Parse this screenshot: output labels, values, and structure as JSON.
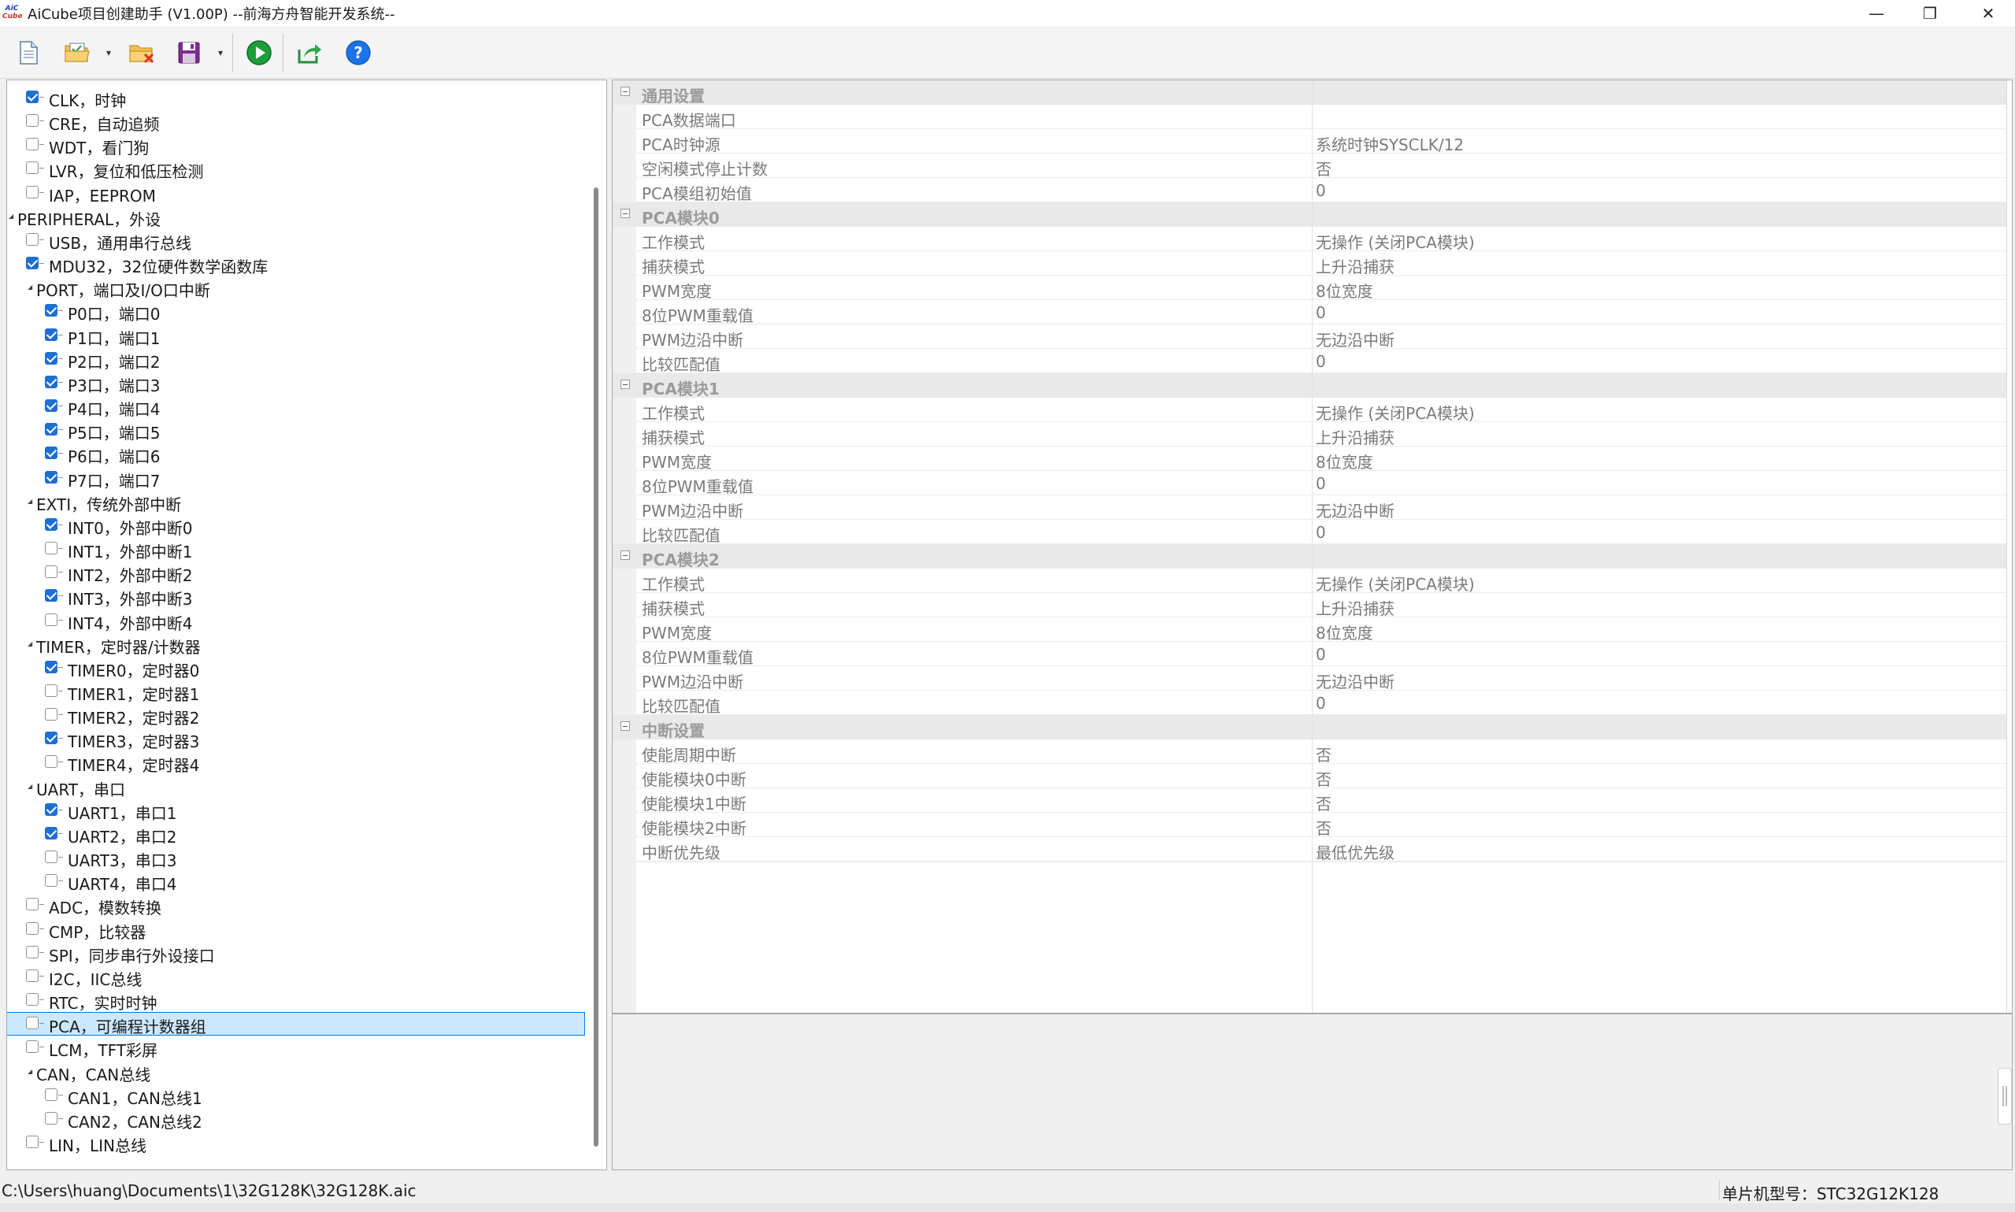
{
  "window": {
    "logo_text_top": "AiC",
    "logo_text_bottom": "Cube",
    "title": "AiCube项目创建助手 (V1.00P) --前海方舟智能开发系统--",
    "minimize_glyph": "—",
    "restore_glyph": "❐",
    "close_glyph": "✕"
  },
  "toolbar": {
    "buttons": [
      {
        "name": "new-project-button",
        "icon": "new-file-icon"
      },
      {
        "name": "open-project-button",
        "icon": "open-folder-icon"
      },
      {
        "name": "close-project-button",
        "icon": "close-folder-icon"
      },
      {
        "name": "save-project-button",
        "icon": "save-disk-icon"
      },
      {
        "name": "run-generate-button",
        "icon": "play-icon"
      },
      {
        "name": "export-button",
        "icon": "export-share-icon"
      },
      {
        "name": "help-button",
        "icon": "help-icon"
      }
    ],
    "dropdown_glyph": "▾"
  },
  "colors": {
    "accent": "#1f6fd1",
    "selection": "#cce8ff",
    "selection_border": "#0078d7",
    "play_green": "#1e9e3a",
    "help_blue": "#1a73e8"
  },
  "tree": {
    "items": [
      {
        "label": "CLK，时钟",
        "level": 1,
        "checkbox": true,
        "checked": true
      },
      {
        "label": "CRE，自动追频",
        "level": 1,
        "checkbox": true,
        "checked": false
      },
      {
        "label": "WDT，看门狗",
        "level": 1,
        "checkbox": true,
        "checked": false
      },
      {
        "label": "LVR，复位和低压检测",
        "level": 1,
        "checkbox": true,
        "checked": false
      },
      {
        "label": "IAP，EEPROM",
        "level": 1,
        "checkbox": true,
        "checked": false
      },
      {
        "label": "PERIPHERAL，外设",
        "level": 0,
        "checkbox": false,
        "expanded": true
      },
      {
        "label": "USB，通用串行总线",
        "level": 1,
        "checkbox": true,
        "checked": false
      },
      {
        "label": "MDU32，32位硬件数学函数库",
        "level": 1,
        "checkbox": true,
        "checked": true
      },
      {
        "label": "PORT，端口及I/O口中断",
        "level": 1,
        "checkbox": false,
        "expanded": true
      },
      {
        "label": "P0口，端口0",
        "level": 2,
        "checkbox": true,
        "checked": true
      },
      {
        "label": "P1口，端口1",
        "level": 2,
        "checkbox": true,
        "checked": true
      },
      {
        "label": "P2口，端口2",
        "level": 2,
        "checkbox": true,
        "checked": true
      },
      {
        "label": "P3口，端口3",
        "level": 2,
        "checkbox": true,
        "checked": true
      },
      {
        "label": "P4口，端口4",
        "level": 2,
        "checkbox": true,
        "checked": true
      },
      {
        "label": "P5口，端口5",
        "level": 2,
        "checkbox": true,
        "checked": true
      },
      {
        "label": "P6口，端口6",
        "level": 2,
        "checkbox": true,
        "checked": true
      },
      {
        "label": "P7口，端口7",
        "level": 2,
        "checkbox": true,
        "checked": true
      },
      {
        "label": "EXTI，传统外部中断",
        "level": 1,
        "checkbox": false,
        "expanded": true
      },
      {
        "label": "INT0，外部中断0",
        "level": 2,
        "checkbox": true,
        "checked": true
      },
      {
        "label": "INT1，外部中断1",
        "level": 2,
        "checkbox": true,
        "checked": false
      },
      {
        "label": "INT2，外部中断2",
        "level": 2,
        "checkbox": true,
        "checked": false
      },
      {
        "label": "INT3，外部中断3",
        "level": 2,
        "checkbox": true,
        "checked": true
      },
      {
        "label": "INT4，外部中断4",
        "level": 2,
        "checkbox": true,
        "checked": false
      },
      {
        "label": "TIMER，定时器/计数器",
        "level": 1,
        "checkbox": false,
        "expanded": true
      },
      {
        "label": "TIMER0，定时器0",
        "level": 2,
        "checkbox": true,
        "checked": true
      },
      {
        "label": "TIMER1，定时器1",
        "level": 2,
        "checkbox": true,
        "checked": false
      },
      {
        "label": "TIMER2，定时器2",
        "level": 2,
        "checkbox": true,
        "checked": false
      },
      {
        "label": "TIMER3，定时器3",
        "level": 2,
        "checkbox": true,
        "checked": true
      },
      {
        "label": "TIMER4，定时器4",
        "level": 2,
        "checkbox": true,
        "checked": false
      },
      {
        "label": "UART，串口",
        "level": 1,
        "checkbox": false,
        "expanded": true
      },
      {
        "label": "UART1，串口1",
        "level": 2,
        "checkbox": true,
        "checked": true
      },
      {
        "label": "UART2，串口2",
        "level": 2,
        "checkbox": true,
        "checked": true
      },
      {
        "label": "UART3，串口3",
        "level": 2,
        "checkbox": true,
        "checked": false
      },
      {
        "label": "UART4，串口4",
        "level": 2,
        "checkbox": true,
        "checked": false
      },
      {
        "label": "ADC，模数转换",
        "level": 1,
        "checkbox": true,
        "checked": false
      },
      {
        "label": "CMP，比较器",
        "level": 1,
        "checkbox": true,
        "checked": false
      },
      {
        "label": "SPI，同步串行外设接口",
        "level": 1,
        "checkbox": true,
        "checked": false
      },
      {
        "label": "I2C，IIC总线",
        "level": 1,
        "checkbox": true,
        "checked": false
      },
      {
        "label": "RTC，实时时钟",
        "level": 1,
        "checkbox": true,
        "checked": false
      },
      {
        "label": "PCA，可编程计数器组",
        "level": 1,
        "checkbox": true,
        "checked": false,
        "selected": true
      },
      {
        "label": "LCM，TFT彩屏",
        "level": 1,
        "checkbox": true,
        "checked": false
      },
      {
        "label": "CAN，CAN总线",
        "level": 1,
        "checkbox": false,
        "expanded": true
      },
      {
        "label": "CAN1，CAN总线1",
        "level": 2,
        "checkbox": true,
        "checked": false
      },
      {
        "label": "CAN2，CAN总线2",
        "level": 2,
        "checkbox": true,
        "checked": false
      },
      {
        "label": "LIN，LIN总线",
        "level": 1,
        "checkbox": true,
        "checked": false
      }
    ]
  },
  "properties": {
    "categories": [
      {
        "name": "通用设置",
        "rows": [
          {
            "name": "PCA数据端口",
            "value": ""
          },
          {
            "name": "PCA时钟源",
            "value": "系统时钟SYSCLK/12"
          },
          {
            "name": "空闲模式停止计数",
            "value": "否"
          },
          {
            "name": "PCA模组初始值",
            "value": "0"
          }
        ]
      },
      {
        "name": "PCA模块0",
        "rows": [
          {
            "name": "工作模式",
            "value": "无操作 (关闭PCA模块)"
          },
          {
            "name": "捕获模式",
            "value": "上升沿捕获"
          },
          {
            "name": "PWM宽度",
            "value": "8位宽度"
          },
          {
            "name": "8位PWM重载值",
            "value": "0"
          },
          {
            "name": "PWM边沿中断",
            "value": "无边沿中断"
          },
          {
            "name": "比较匹配值",
            "value": "0"
          }
        ]
      },
      {
        "name": "PCA模块1",
        "rows": [
          {
            "name": "工作模式",
            "value": "无操作 (关闭PCA模块)"
          },
          {
            "name": "捕获模式",
            "value": "上升沿捕获"
          },
          {
            "name": "PWM宽度",
            "value": "8位宽度"
          },
          {
            "name": "8位PWM重载值",
            "value": "0"
          },
          {
            "name": "PWM边沿中断",
            "value": "无边沿中断"
          },
          {
            "name": "比较匹配值",
            "value": "0"
          }
        ]
      },
      {
        "name": "PCA模块2",
        "rows": [
          {
            "name": "工作模式",
            "value": "无操作 (关闭PCA模块)"
          },
          {
            "name": "捕获模式",
            "value": "上升沿捕获"
          },
          {
            "name": "PWM宽度",
            "value": "8位宽度"
          },
          {
            "name": "8位PWM重载值",
            "value": "0"
          },
          {
            "name": "PWM边沿中断",
            "value": "无边沿中断"
          },
          {
            "name": "比较匹配值",
            "value": "0"
          }
        ]
      },
      {
        "name": "中断设置",
        "rows": [
          {
            "name": "使能周期中断",
            "value": "否"
          },
          {
            "name": "使能模块0中断",
            "value": "否"
          },
          {
            "name": "使能模块1中断",
            "value": "否"
          },
          {
            "name": "使能模块2中断",
            "value": "否"
          },
          {
            "name": "中断优先级",
            "value": "最低优先级"
          }
        ]
      }
    ]
  },
  "statusbar": {
    "path": "C:\\Users\\huang\\Documents\\1\\32G128K\\32G128K.aic",
    "model": "单片机型号：STC32G12K128"
  }
}
